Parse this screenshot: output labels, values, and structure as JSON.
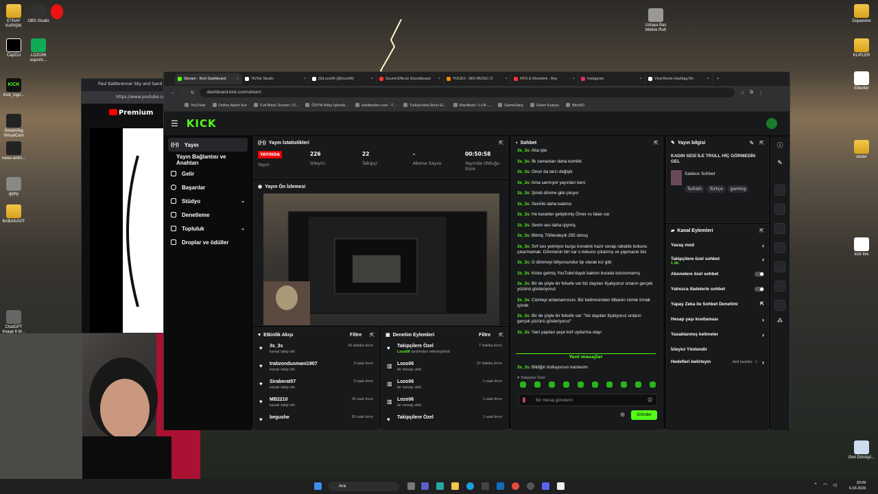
{
  "desktop": {
    "left_icons": [
      {
        "label": "ETRAF KARIŞIK"
      },
      {
        "label": "OBS Studio"
      },
      {
        "label": "CapCut"
      },
      {
        "label": "LOZO06 esports..."
      },
      {
        "label": "Kick_logo..."
      },
      {
        "label": "Streamfog VirtualCam"
      },
      {
        "label": "news-anim..."
      },
      {
        "label": "giphy"
      },
      {
        "label": "BABAKAVIT"
      },
      {
        "label": "ChatGPT Image 6 M..."
      }
    ],
    "right_icons": [
      {
        "label": "Dopamine"
      },
      {
        "label": "KLIPLER"
      },
      {
        "label": "Etiketler"
      },
      {
        "label": "sesler"
      },
      {
        "label": "kick live"
      },
      {
        "label": "Geri Dönüşü..."
      }
    ],
    "center_icon": "Ustaya Bas Motive Ruh"
  },
  "youtube_window": {
    "tab": "Paul Kalkbrenner Sky and Sand",
    "url": "https://www.youtube.com",
    "logo": "Premium"
  },
  "browser": {
    "tabs": [
      {
        "label": "Stream - Kick Dashboard",
        "color": "#53fc18"
      },
      {
        "label": "TikTok Studio",
        "color": "#ffffff"
      },
      {
        "label": "(5)Lozo06 (@lozo06)",
        "color": "#ffffff"
      },
      {
        "label": "Sound Effects Soundboard",
        "color": "#ff3333"
      },
      {
        "label": "YOUDJ - MIX MUSIC O",
        "color": "#ff8800"
      },
      {
        "label": "NTO & Monolink - Bey",
        "color": "#ff3333"
      },
      {
        "label": "Instagram",
        "color": "#e1306c"
      },
      {
        "label": "Viral Reels Hashtag Re",
        "color": "#ffffff"
      }
    ],
    "url": "dashboard.kick.com/stream",
    "bookmarks": [
      "YouTube",
      "Online Alarm Kur",
      "Full Black Screen | O...",
      "ÖSYM Aday İşlemle...",
      "sahibinden.com - T...",
      "Türkiye'deki İkinci El...",
      "Manifests / LUA -...",
      "GameSatış",
      "Gelen Kutusu",
      "BlindID"
    ]
  },
  "kick": {
    "logo": "KICK",
    "nav": [
      {
        "label": "Yayın",
        "icon": "broadcast-icon"
      },
      {
        "label": "Yayın Bağlantısı ve Anahtarı",
        "icon": ""
      },
      {
        "label": "Gelir",
        "icon": "money-icon"
      },
      {
        "label": "Başarılar",
        "icon": "trophy-icon"
      },
      {
        "label": "Stüdyo",
        "icon": "studio-icon"
      },
      {
        "label": "Denetleme",
        "icon": "shield-icon"
      },
      {
        "label": "Topluluk",
        "icon": "people-icon"
      },
      {
        "label": "Droplar ve ödüller",
        "icon": "gift-icon"
      }
    ],
    "stats": {
      "title": "Yayın İstatistikleri",
      "live": "YAYINDA",
      "live_label": "Yayın",
      "viewers": "226",
      "viewers_label": "İzleyici",
      "followers": "22",
      "followers_label": "Takipçi",
      "subs": "-",
      "subs_label": "Abone Sayısı",
      "duration": "00:50:58",
      "duration_label": "Yayında Olduğu Süre"
    },
    "preview": {
      "title": "Yayın Ön İzlemesi"
    },
    "activity": {
      "title": "Etkinlik Akışı",
      "filter": "Filtre",
      "rows": [
        {
          "name": "3s_3s",
          "sub": "kanalı takip etti",
          "time": "26 dakika önce"
        },
        {
          "name": "trabzondusmani1907",
          "sub": "kanalı takip etti",
          "time": "3 saat önce"
        },
        {
          "name": "Siraberat07",
          "sub": "kanalı takip etti",
          "time": "3 saat önce"
        },
        {
          "name": "MB2210",
          "sub": "kanalı takip etti",
          "time": "16 saat önce"
        },
        {
          "name": "begushe",
          "sub": "",
          "time": "20 saat önce"
        }
      ]
    },
    "moderation": {
      "title": "Denetim Eylemleri",
      "filter": "Filtre",
      "rows": [
        {
          "name": "Takipçilere Özel",
          "sub_user": "Lozo06",
          "sub": "tarafından etkinleştirildi",
          "time": "7 dakika önce"
        },
        {
          "name": "Lozo06",
          "sub_user": "",
          "sub": "bir mesajı sildi",
          "time": "37 dakika önce"
        },
        {
          "name": "Lozo06",
          "sub_user": "",
          "sub": "bir mesajı sildi",
          "time": "1 saat önce"
        },
        {
          "name": "Lozo06",
          "sub_user": "",
          "sub": "bir mesajı sildi",
          "time": "1 saat önce"
        },
        {
          "name": "Takipçilere Özel",
          "sub_user": "",
          "sub": "",
          "time": "1 saat önce"
        }
      ]
    },
    "chat": {
      "title": "Sohbet",
      "user": "3s_3s",
      "messages": [
        "Aha işte",
        "İlk zamanları daha komikti",
        "Onun da tarzı değişik",
        "Ama sarmıyor yayınları beni",
        "Şimdi dönme gibi çıkıyor",
        "Senin̈ki daha kadınsı",
        "He karakter geliştirmiş Ömer vs falan var",
        "Senin ses daha iyiymiş",
        "Bitmiş 700lerdeydi 255 olmuş",
        "Sırf ses yetmiyor kurgu kıvraklık hazır cevap rahatlık bokunu çıkarmamak. Dönmenin biri var o bokunu çıkarmış ve yapmacık itici",
        "O dönmeyi biliyorsundur tip olarak kız gibi",
        "Kicke gelmiş YouTube'daydı baktım burada tutunsmamış",
        "Bir de şöyle bir felsefe var biz dayıları ifşalıyoruz onların gerçek yüzünü gösteriyoruz",
        "Cümleyi anlamamıssın. Biz kelimesinden itibaren cümle tırnak içinde",
        "Bir de şöyle bir felsefe var: \"biz dayıları ifşalıyoruz onların gerçek yüzünü gösteriyoruz\"",
        "Yani yapılan şeye kılıf uydurma olayı"
      ],
      "new_label": "Yeni mesajlar",
      "last_message": "Bildiğin trolluyorsun kardesim",
      "followers_only": "Takipçiler Özel",
      "placeholder": "Bir mesaj gönderin",
      "send": "Gönder"
    },
    "info": {
      "title": "Yayın bilgisi",
      "stream_title": "KADIN SESİ İLE TROLL HİÇ GÖRMEDİN GEL",
      "category": "Sadece Sohbet",
      "tags": [
        "Turkish",
        "Türkçe",
        "gaming"
      ]
    },
    "channel": {
      "title": "Kanal Eylemleri",
      "items": [
        {
          "label": "Yavaş mod",
          "control": "arrow"
        },
        {
          "label": "Takipçilere özel sohbet",
          "sub": "1 dk.",
          "control": "arrow"
        },
        {
          "label": "Abonelere özel sohbet",
          "control": "toggle"
        },
        {
          "label": "Yalnızca ifadelerle sohbet",
          "control": "toggle"
        },
        {
          "label": "Yapay Zeka ile Sohbet Denetimi",
          "control": "ext"
        },
        {
          "label": "Hesap yaşı kısıtlaması",
          "control": "arrow"
        },
        {
          "label": "Yasaklanmış kelimeler",
          "control": "arrow"
        },
        {
          "label": "İzleyici Yönlendir",
          "control": "none"
        },
        {
          "label": "Hedefleri belirleyin",
          "badge": "Aktif hedefler - 1",
          "control": "arrow"
        }
      ]
    }
  },
  "taskbar": {
    "search": "Ara",
    "time": "20:09",
    "date": "6.03.2026"
  }
}
